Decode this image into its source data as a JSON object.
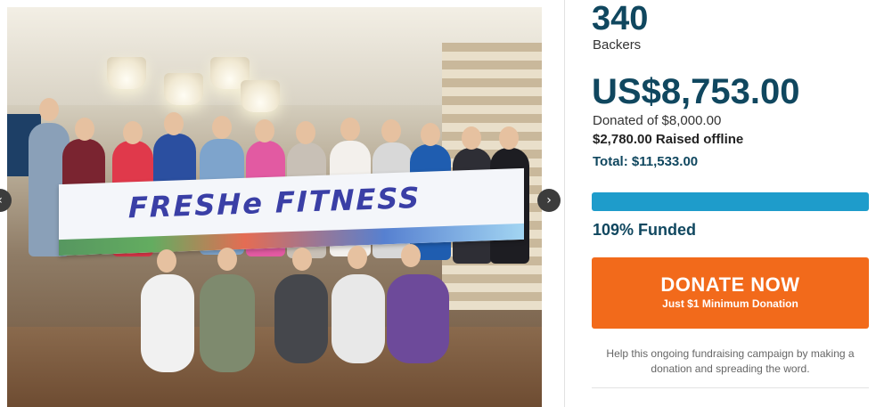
{
  "campaign": {
    "photo_alt": "Group photo of fitness class members holding a banner",
    "banner_text": "FRESHe FITNESS"
  },
  "stats": {
    "backers_count": "340",
    "backers_label": "Backers",
    "amount": "US$8,753.00",
    "donated_of": "Donated of $8,000.00",
    "raised_offline": "$2,780.00 Raised offline",
    "total": "Total: $11,533.00",
    "funded_label": "109% Funded",
    "funded_fraction": 1.0
  },
  "donate": {
    "title": "DONATE NOW",
    "subtitle": "Just $1 Minimum Donation"
  },
  "help_text": "Help this ongoing fundraising campaign by making a donation and spreading the word.",
  "carousel": {
    "prev_icon": "‹",
    "next_icon": "›"
  },
  "colors": {
    "accent_dark": "#10475f",
    "progress": "#1e9ccb",
    "donate": "#f26a1b"
  }
}
